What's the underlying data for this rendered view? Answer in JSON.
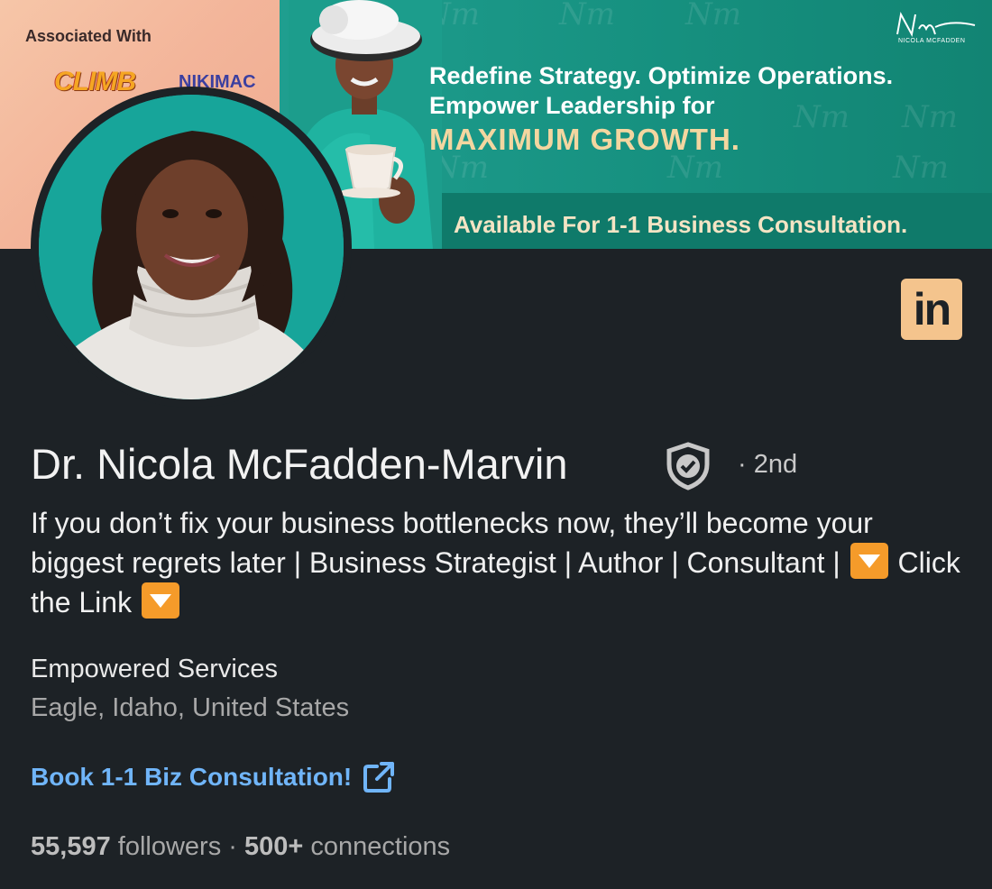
{
  "banner": {
    "associated_label": "Associated With",
    "logos": [
      "CLIMB",
      "NIKIMAC"
    ],
    "headline_line1": "Redefine Strategy. Optimize Operations.",
    "headline_line2": "Empower Leadership for",
    "headline_accent": "MAXIMUM GROWTH.",
    "cta": "Available For 1-1 Business Consultation.",
    "brand_name": "NICOLA MCFADDEN",
    "colors": {
      "teal": "#16907f",
      "peach": "#f3b59a",
      "accent_text": "#f3d6a0"
    }
  },
  "profile": {
    "name": "Dr. Nicola McFadden-Marvin",
    "verified_icon": "verified-shield-icon",
    "degree": "· 2nd",
    "headline_part1": "If you don’t fix your business bottlenecks now, they’ll become your biggest regrets later | Business Strategist | Author | Consultant |",
    "headline_link_text": "Click the Link",
    "company": "Empowered Services",
    "location": "Eagle, Idaho, United States",
    "website_label": "Book 1-1 Biz Consultation!",
    "followers_count": "55,597",
    "followers_label": "followers",
    "separator": "·",
    "connections_count": "500+",
    "connections_label": "connections"
  },
  "linkedin_badge": {
    "label": "in",
    "color": "#f4c48d"
  },
  "theme": {
    "background": "#1d2226",
    "link": "#70b5f9"
  }
}
